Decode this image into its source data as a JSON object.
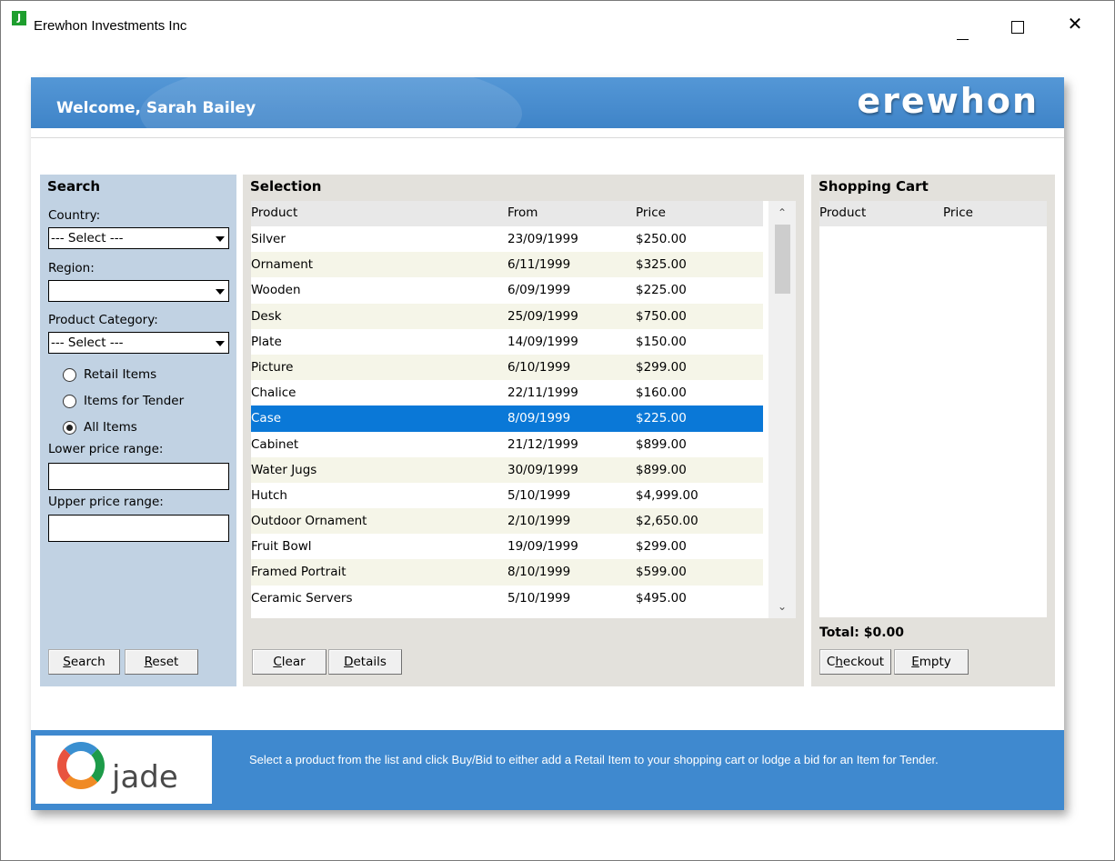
{
  "window": {
    "title": "Erewhon Investments Inc",
    "icon_letter": "J"
  },
  "banner": {
    "welcome": "Welcome, Sarah Bailey",
    "brand": "erewhon"
  },
  "search": {
    "title": "Search",
    "country_label": "Country:",
    "country_value": "--- Select ---",
    "region_label": "Region:",
    "region_value": "",
    "category_label": "Product Category:",
    "category_value": "--- Select ---",
    "radios": [
      {
        "label": "Retail Items",
        "checked": false
      },
      {
        "label": "Items for Tender",
        "checked": false
      },
      {
        "label": "All Items",
        "checked": true
      }
    ],
    "lower_label": "Lower price range:",
    "upper_label": "Upper price range:",
    "search_button": {
      "prefix": "",
      "accel": "S",
      "rest": "earch"
    },
    "reset_button": {
      "prefix": "",
      "accel": "R",
      "rest": "eset"
    }
  },
  "selection": {
    "title": "Selection",
    "columns": {
      "product": "Product",
      "from": "From",
      "price": "Price"
    },
    "rows": [
      {
        "product": "Silver",
        "from": "23/09/1999",
        "price": "$250.00"
      },
      {
        "product": "Ornament",
        "from": "6/11/1999",
        "price": "$325.00"
      },
      {
        "product": "Wooden",
        "from": "6/09/1999",
        "price": "$225.00"
      },
      {
        "product": "Desk",
        "from": "25/09/1999",
        "price": "$750.00"
      },
      {
        "product": "Plate",
        "from": "14/09/1999",
        "price": "$150.00"
      },
      {
        "product": "Picture",
        "from": "6/10/1999",
        "price": "$299.00"
      },
      {
        "product": "Chalice",
        "from": "22/11/1999",
        "price": "$160.00"
      },
      {
        "product": "Case",
        "from": "8/09/1999",
        "price": "$225.00"
      },
      {
        "product": "Cabinet",
        "from": "21/12/1999",
        "price": "$899.00"
      },
      {
        "product": "Water Jugs",
        "from": "30/09/1999",
        "price": "$899.00"
      },
      {
        "product": "Hutch",
        "from": "5/10/1999",
        "price": "$4,999.00"
      },
      {
        "product": "Outdoor Ornament",
        "from": "2/10/1999",
        "price": "$2,650.00"
      },
      {
        "product": "Fruit Bowl",
        "from": "19/09/1999",
        "price": "$299.00"
      },
      {
        "product": "Framed Portrait",
        "from": "8/10/1999",
        "price": "$599.00"
      },
      {
        "product": "Ceramic Servers",
        "from": "5/10/1999",
        "price": "$495.00"
      }
    ],
    "selected_index": 7,
    "clear_button": {
      "prefix": "",
      "accel": "C",
      "rest": "lear"
    },
    "details_button": {
      "prefix": "",
      "accel": "D",
      "rest": "etails"
    },
    "scroll_up_glyph": "⌃",
    "scroll_down_glyph": "⌄"
  },
  "cart": {
    "title": "Shopping Cart",
    "columns": {
      "product": "Product",
      "price": "Price"
    },
    "total": "Total: $0.00",
    "checkout_button": {
      "prefix": "C",
      "accel": "h",
      "rest": "eckout"
    },
    "empty_button": {
      "prefix": "",
      "accel": "E",
      "rest": "mpty"
    }
  },
  "footer": {
    "logo_word": "jade",
    "message": "Select a product from the list and click Buy/Bid to either add a Retail Item to your shopping cart or lodge a bid for an Item for Tender."
  }
}
